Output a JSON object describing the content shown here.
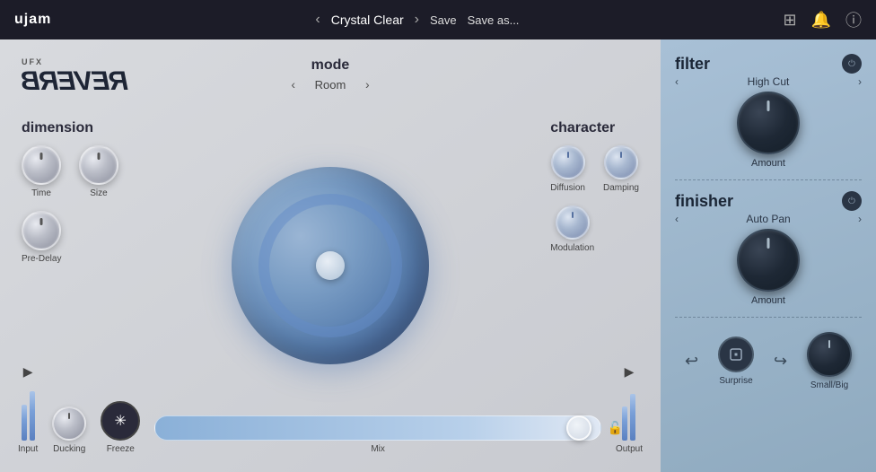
{
  "topbar": {
    "brand": "ujam",
    "preset": "Crystal Clear",
    "save_label": "Save",
    "save_as_label": "Save as...",
    "nav_prev": "‹",
    "nav_next": "›"
  },
  "mode": {
    "label": "mode",
    "value": "Room",
    "prev_arrow": "‹",
    "next_arrow": "›"
  },
  "logo": {
    "ufx": "UFX",
    "reverb": "REVERB"
  },
  "dimension": {
    "label": "dimension",
    "knobs": [
      {
        "id": "time",
        "label": "Time"
      },
      {
        "id": "size",
        "label": "Size"
      },
      {
        "id": "pre-delay",
        "label": "Pre-Delay"
      }
    ]
  },
  "character": {
    "label": "character",
    "knobs": [
      {
        "id": "diffusion",
        "label": "Diffusion"
      },
      {
        "id": "damping",
        "label": "Damping"
      },
      {
        "id": "modulation",
        "label": "Modulation"
      }
    ]
  },
  "bottom": {
    "input_label": "Input",
    "ducking_label": "Ducking",
    "freeze_label": "Freeze",
    "mix_label": "Mix",
    "output_label": "Output",
    "freeze_icon": "✳"
  },
  "filter": {
    "title": "filter",
    "value": "High Cut",
    "amount_label": "Amount"
  },
  "finisher": {
    "title": "finisher",
    "value": "Auto Pan",
    "amount_label": "Amount"
  },
  "right_bottom": {
    "surprise_label": "Surprise",
    "small_big_label": "Small/Big"
  }
}
